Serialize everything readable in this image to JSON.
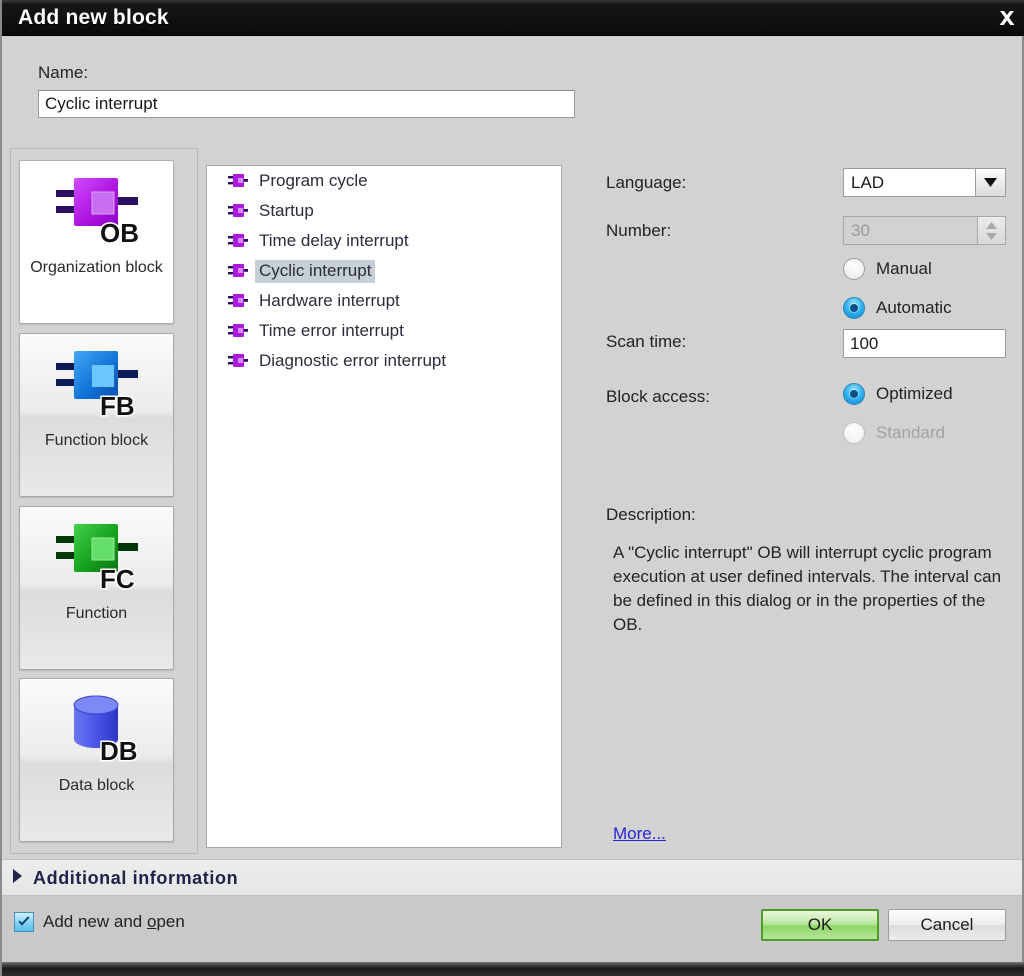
{
  "window": {
    "title": "Add new block",
    "close_icon": "close-icon"
  },
  "name_field": {
    "label": "Name:",
    "value": "Cyclic interrupt",
    "placeholder": ""
  },
  "block_types": [
    {
      "label": "Organization block",
      "abbr": "OB",
      "icon": "organization-block-icon",
      "selected": true
    },
    {
      "label": "Function block",
      "abbr": "FB",
      "icon": "function-block-icon",
      "selected": false
    },
    {
      "label": "Function",
      "abbr": "FC",
      "icon": "function-icon",
      "selected": false
    },
    {
      "label": "Data block",
      "abbr": "DB",
      "icon": "data-block-icon",
      "selected": false
    }
  ],
  "ob_list": [
    {
      "label": "Program cycle",
      "selected": false
    },
    {
      "label": "Startup",
      "selected": false
    },
    {
      "label": "Time delay interrupt",
      "selected": false
    },
    {
      "label": "Cyclic interrupt",
      "selected": true
    },
    {
      "label": "Hardware interrupt",
      "selected": false
    },
    {
      "label": "Time error interrupt",
      "selected": false
    },
    {
      "label": "Diagnostic error interrupt",
      "selected": false
    }
  ],
  "properties": {
    "language_label": "Language:",
    "language_value": "LAD",
    "number_label": "Number:",
    "number_value": "30",
    "number_disabled": true,
    "numbering_options": [
      {
        "label": "Manual",
        "selected": false,
        "disabled": false
      },
      {
        "label": "Automatic",
        "selected": true,
        "disabled": false
      }
    ],
    "scan_time_label": "Scan time:",
    "scan_time_value": "100",
    "block_access_label": "Block access:",
    "block_access_options": [
      {
        "label": "Optimized",
        "selected": true,
        "disabled": false
      },
      {
        "label": "Standard",
        "selected": false,
        "disabled": true
      }
    ],
    "description_label": "Description:",
    "description_text": "A \"Cyclic interrupt\" OB will interrupt cyclic program execution at user defined intervals. The interval can be defined in this dialog or in the properties of the OB.",
    "more_link": "More..."
  },
  "additional_information": {
    "label": "Additional  information",
    "expander_icon": "chevron-right-icon",
    "expanded": false
  },
  "footer": {
    "add_new_and_open_label_prefix": "Add new and ",
    "add_new_and_open_label_accel": "o",
    "add_new_and_open_label_suffix": "pen",
    "add_new_and_open_checked": true,
    "ok_label": "OK",
    "cancel_label": "Cancel"
  },
  "colors": {
    "title_bar": "#0b0b0b",
    "dialog_bg": "#d2d2d2",
    "accent_ob": "#b026d9",
    "accent_fb": "#1e7fe0",
    "accent_fc": "#16a016",
    "accent_db": "#4a55e8",
    "selection": "#c6ced6",
    "link": "#2a23d6",
    "ok_green": "#8ed667",
    "radio_on": "#35b6ef"
  }
}
